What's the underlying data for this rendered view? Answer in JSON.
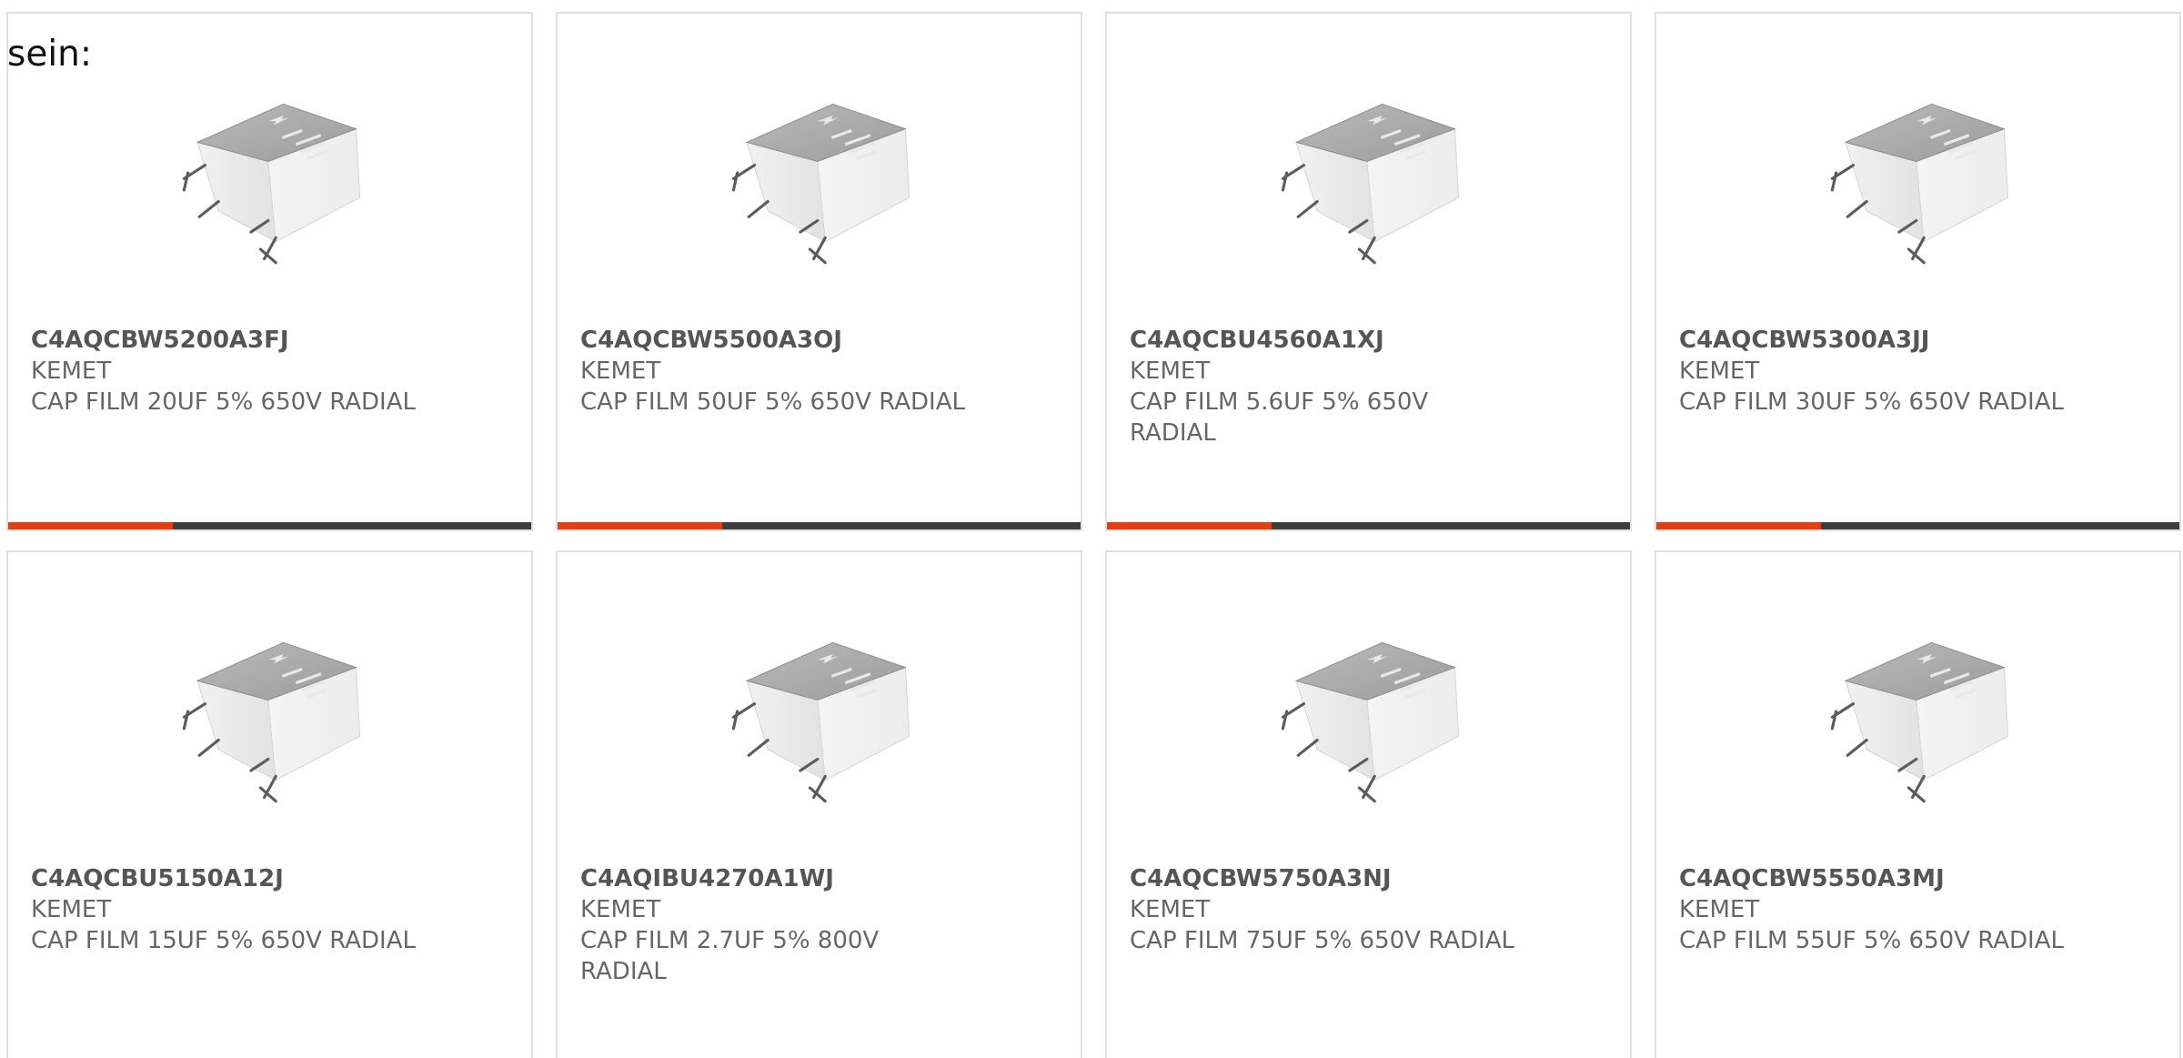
{
  "intro_text": "sein:",
  "colors": {
    "accent": "#e0400f",
    "bar": "#3d3d3d",
    "card_border": "#e0e0e0",
    "text": "#666666"
  },
  "image_icon": "film-capacitor-image",
  "products": [
    {
      "part_number": "C4AQCBW5200A3FJ",
      "manufacturer": "KEMET",
      "description": "CAP FILM 20UF 5% 650V RADIAL"
    },
    {
      "part_number": "C4AQCBW5500A3OJ",
      "manufacturer": "KEMET",
      "description": "CAP FILM 50UF 5% 650V RADIAL"
    },
    {
      "part_number": "C4AQCBU4560A1XJ",
      "manufacturer": "KEMET",
      "description": "CAP FILM 5.6UF 5% 650V RADIAL"
    },
    {
      "part_number": "C4AQCBW5300A3JJ",
      "manufacturer": "KEMET",
      "description": "CAP FILM 30UF 5% 650V RADIAL"
    },
    {
      "part_number": "C4AQCBU5150A12J",
      "manufacturer": "KEMET",
      "description": "CAP FILM 15UF 5% 650V RADIAL"
    },
    {
      "part_number": "C4AQIBU4270A1WJ",
      "manufacturer": "KEMET",
      "description": "CAP FILM 2.7UF 5% 800V RADIAL"
    },
    {
      "part_number": "C4AQCBW5750A3NJ",
      "manufacturer": "KEMET",
      "description": "CAP FILM 75UF 5% 650V RADIAL"
    },
    {
      "part_number": "C4AQCBW5550A3MJ",
      "manufacturer": "KEMET",
      "description": "CAP FILM 55UF 5% 650V RADIAL"
    }
  ]
}
